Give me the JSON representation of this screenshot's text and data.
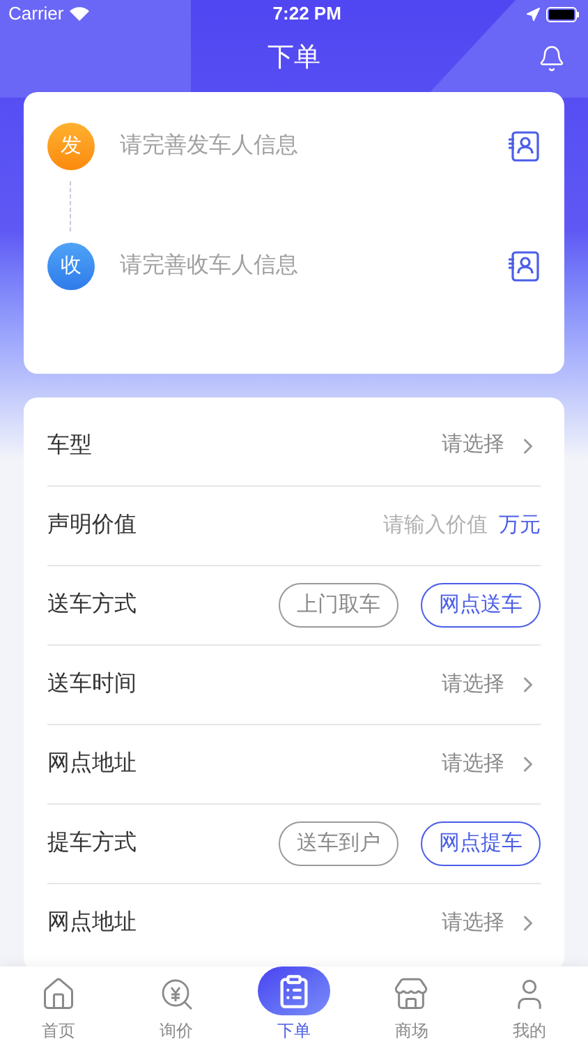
{
  "status_bar": {
    "carrier": "Carrier",
    "time": "7:22 PM"
  },
  "nav": {
    "title": "下单"
  },
  "contacts": [
    {
      "kind": "sender",
      "badge": "发",
      "placeholder": "请完善发车人信息"
    },
    {
      "kind": "receiver",
      "badge": "收",
      "placeholder": "请完善收车人信息"
    }
  ],
  "form": [
    {
      "kind": "select",
      "label": "车型",
      "value": "请选择"
    },
    {
      "kind": "input",
      "label": "声明价值",
      "placeholder": "请输入价值",
      "unit": "万元"
    },
    {
      "kind": "options",
      "label": "送车方式",
      "options": [
        {
          "label": "上门取车",
          "selected": false
        },
        {
          "label": "网点送车",
          "selected": true
        }
      ]
    },
    {
      "kind": "select",
      "label": "送车时间",
      "value": "请选择"
    },
    {
      "kind": "select",
      "label": "网点地址",
      "value": "请选择"
    },
    {
      "kind": "options",
      "label": "提车方式",
      "options": [
        {
          "label": "送车到户",
          "selected": false
        },
        {
          "label": "网点提车",
          "selected": true
        }
      ]
    },
    {
      "kind": "select",
      "label": "网点地址",
      "value": "请选择"
    }
  ],
  "tab_bar": [
    {
      "kind": "home",
      "label": "首页",
      "selected": false
    },
    {
      "kind": "price",
      "label": "询价",
      "selected": false
    },
    {
      "kind": "order",
      "label": "下单",
      "selected": true
    },
    {
      "kind": "shop",
      "label": "商场",
      "selected": false
    },
    {
      "kind": "profile",
      "label": "我的",
      "selected": false
    }
  ]
}
